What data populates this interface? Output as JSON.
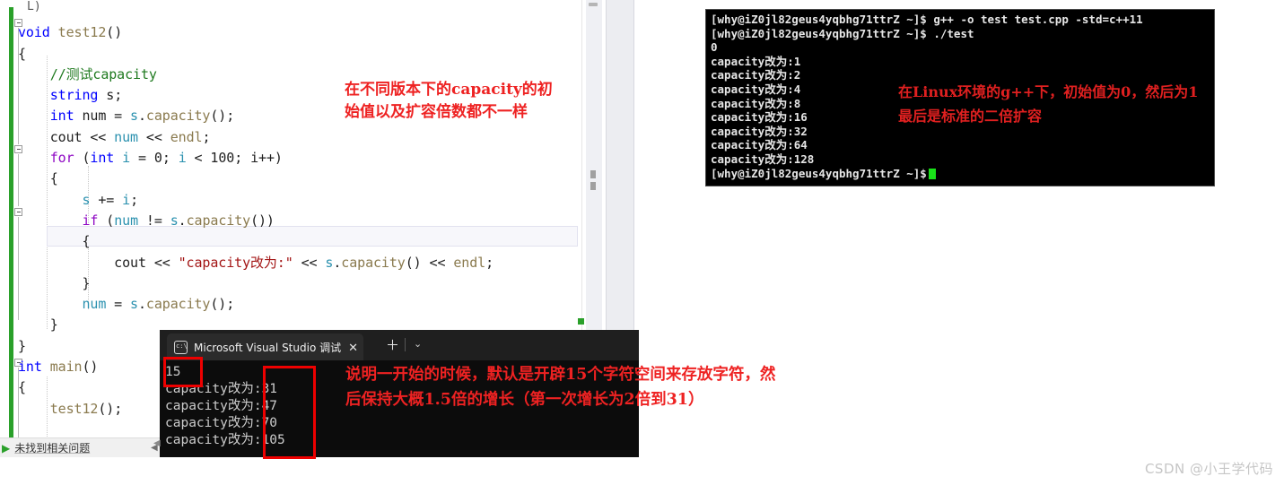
{
  "editor": {
    "language": "cpp",
    "status_bar": {
      "text": "未找到相关问题",
      "arrow_icon": "play-icon",
      "nav_icon": "left-arrow-icon"
    },
    "partial_top_line": "L)",
    "code_lines": [
      "void test12()",
      "{",
      "    //测试capacity",
      "    string s;",
      "    int num = s.capacity();",
      "    cout << num << endl;",
      "    for (int i = 0; i < 100; i++)",
      "    {",
      "        s += i;",
      "        if (num != s.capacity())",
      "        {",
      "            cout << \"capacity改为:\" << s.capacity() << endl;",
      "        }",
      "        num = s.capacity();",
      "    }",
      "}",
      "int main()",
      "{",
      "    test12();"
    ],
    "annotation": "在不同版本下的capacity的初\n始值以及扩容倍数都不一样"
  },
  "terminal": {
    "prompt": "[why@iZ0jl82geus4yqbhg71ttrZ ~]$",
    "lines": [
      "[why@iZ0jl82geus4yqbhg71ttrZ ~]$ g++ -o test test.cpp -std=c++11",
      "[why@iZ0jl82geus4yqbhg71ttrZ ~]$ ./test",
      "0",
      "capacity改为:1",
      "capacity改为:2",
      "capacity改为:4",
      "capacity改为:8",
      "capacity改为:16",
      "capacity改为:32",
      "capacity改为:64",
      "capacity改为:128"
    ],
    "last_prompt": "[why@iZ0jl82geus4yqbhg71ttrZ ~]$",
    "cursor_color": "#19e219",
    "annotation": "在Linux环境的g++下，初始值为0，然后为1\n最后是标准的二倍扩容"
  },
  "console_window": {
    "tab": {
      "title": "Microsoft Visual Studio 调试",
      "icon": "console-app-icon",
      "close_label": "✕",
      "new_tab_label": "＋",
      "dropdown_label": "⌄"
    },
    "output_lines": [
      "15",
      "capacity改为:31",
      "capacity改为:47",
      "capacity改为:70",
      "capacity改为:105"
    ],
    "annotation": "说明一开始的时候，默认是开辟15个字符空间来存放字符，然\n后保持大概1.5倍的增长（第一次增长为2倍到31）"
  },
  "watermark": {
    "text": "CSDN @小王学代码"
  },
  "colors": {
    "annotation_red": "#ee2222",
    "terminal_bg": "#000000",
    "console_bg": "#0c0c0c",
    "highlight_box": "#ee0000",
    "change_bar_green": "#2aa02a"
  }
}
